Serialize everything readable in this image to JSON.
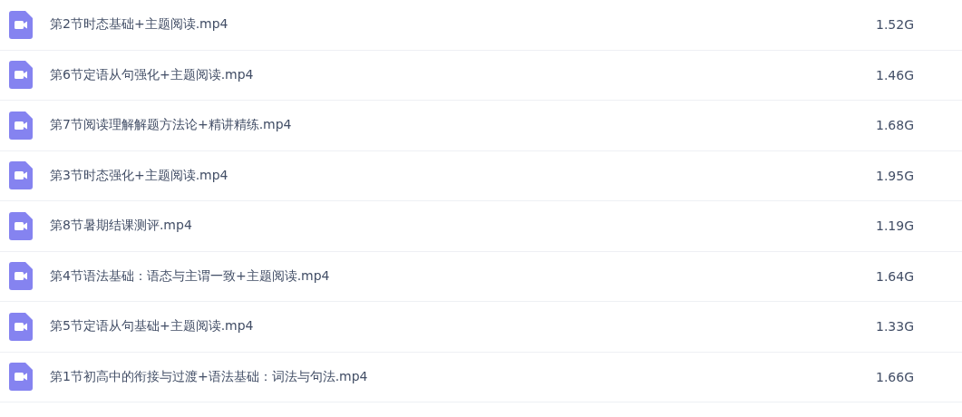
{
  "files": [
    {
      "name": "第2节时态基础+主题阅读.mp4",
      "size": "1.52G"
    },
    {
      "name": "第6节定语从句强化+主题阅读.mp4",
      "size": "1.46G"
    },
    {
      "name": "第7节阅读理解解题方法论+精讲精练.mp4",
      "size": "1.68G"
    },
    {
      "name": "第3节时态强化+主题阅读.mp4",
      "size": "1.95G"
    },
    {
      "name": "第8节暑期结课测评.mp4",
      "size": "1.19G"
    },
    {
      "name": "第4节语法基础：语态与主谓一致+主题阅读.mp4",
      "size": "1.64G"
    },
    {
      "name": "第5节定语从句基础+主题阅读.mp4",
      "size": "1.33G"
    },
    {
      "name": "第1节初高中的衔接与过渡+语法基础：词法与句法.mp4",
      "size": "1.66G"
    }
  ]
}
